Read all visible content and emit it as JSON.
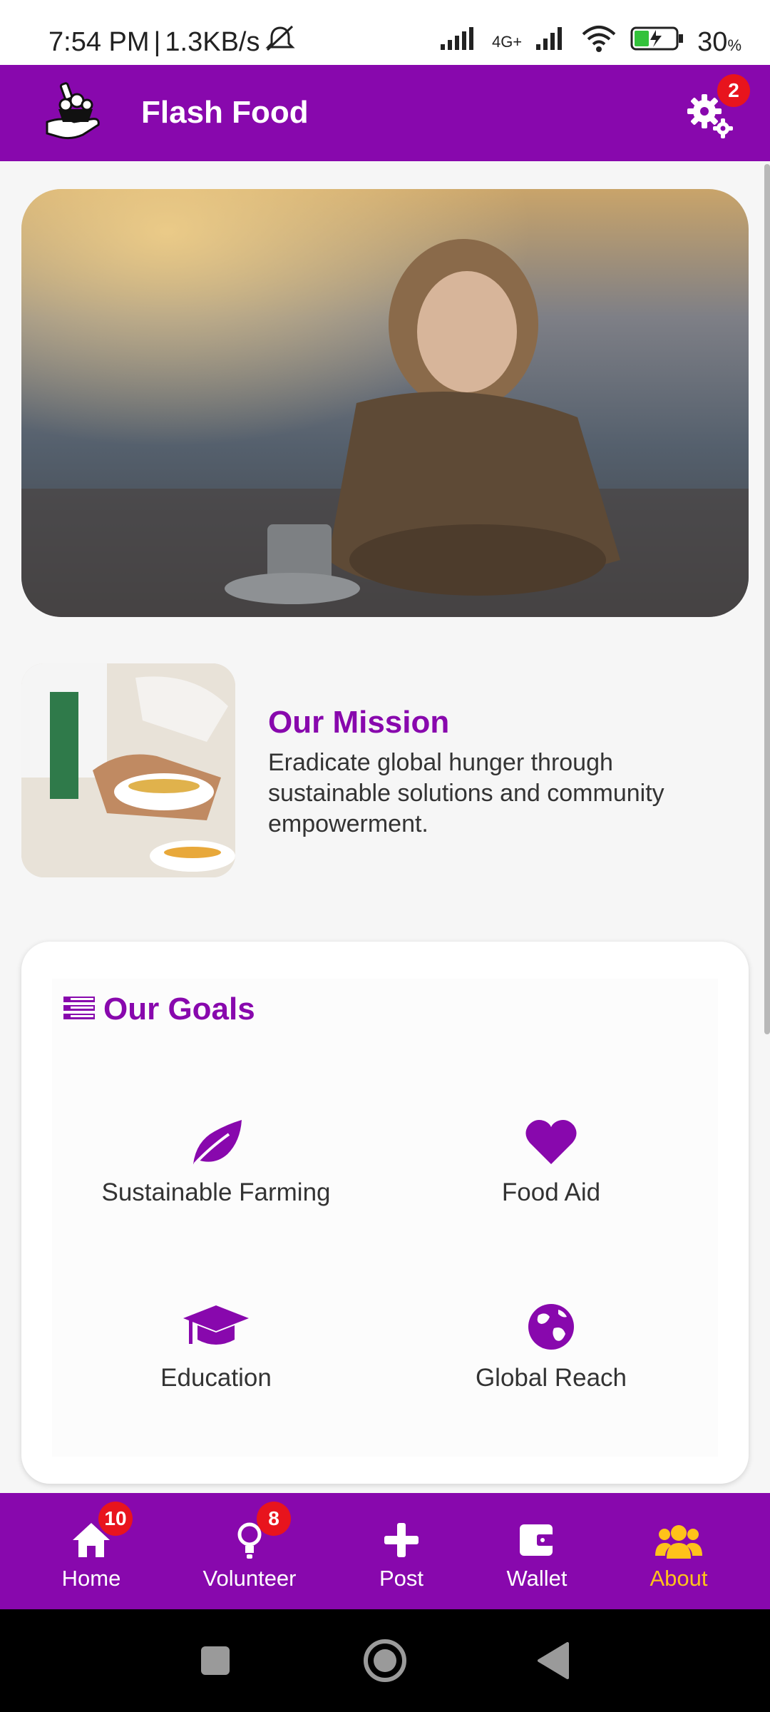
{
  "status_bar": {
    "time": "7:54 PM",
    "separator": "|",
    "network_speed": "1.3KB/s",
    "network_type": "4G+",
    "battery": "30",
    "battery_unit": "%"
  },
  "app_bar": {
    "title": "Flash Food",
    "settings_badge": "2"
  },
  "mission": {
    "title": "Our Mission",
    "text": "Eradicate global hunger through sustainable solutions and community empowerment."
  },
  "goals": {
    "title": "Our Goals",
    "items": [
      {
        "label": "Sustainable Farming",
        "icon": "leaf-icon"
      },
      {
        "label": "Food Aid",
        "icon": "heart-icon"
      },
      {
        "label": "Education",
        "icon": "graduation-cap-icon"
      },
      {
        "label": "Global Reach",
        "icon": "globe-icon"
      }
    ]
  },
  "nav": {
    "items": [
      {
        "label": "Home",
        "badge": "10",
        "icon": "home-icon"
      },
      {
        "label": "Volunteer",
        "badge": "8",
        "icon": "volunteer-icon"
      },
      {
        "label": "Post",
        "icon": "plus-icon"
      },
      {
        "label": "Wallet",
        "icon": "wallet-icon"
      },
      {
        "label": "About",
        "icon": "users-icon",
        "active": true
      }
    ]
  },
  "colors": {
    "primary": "#8808ad",
    "active_nav": "#ffc21a",
    "badge": "#e8141d"
  }
}
